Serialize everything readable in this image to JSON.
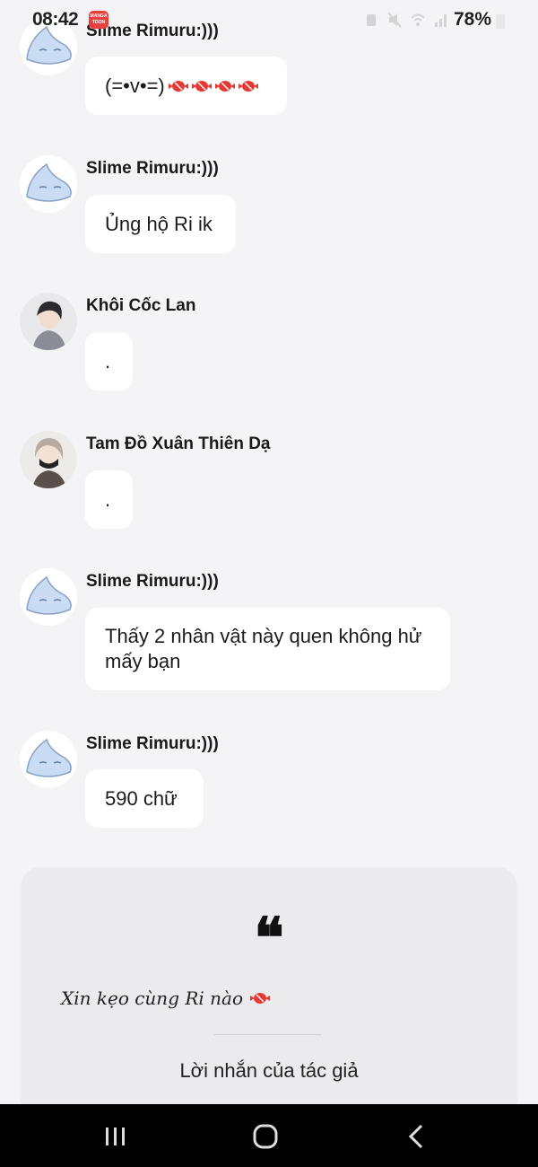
{
  "status_bar": {
    "time": "08:42",
    "app_badge": "MANGA TOON",
    "battery": "78%"
  },
  "messages": [
    {
      "user": "Slime Rimuru:)))",
      "text": "(=•v•=)",
      "candies": 4
    },
    {
      "user": "Slime Rimuru:)))",
      "text": "Ủng hộ Ri ik"
    },
    {
      "user": "Khôi Cốc Lan",
      "text": "."
    },
    {
      "user": "Tam Đồ Xuân Thiên Dạ",
      "text": "."
    },
    {
      "user": "Slime Rimuru:)))",
      "text": "Thấy 2 nhân vật này quen không hử mấy bạn"
    },
    {
      "user": "Slime Rimuru:)))",
      "text": "590 chữ"
    }
  ],
  "author_card": {
    "quote_mark": "❝",
    "note": "Xin kẹo cùng Ri nào",
    "caption": "Lời nhắn của tác giả"
  },
  "nav": {
    "icons": [
      "recent-apps-icon",
      "home-icon",
      "back-icon"
    ]
  },
  "colors": {
    "background": "#f4f4f6",
    "bubble": "#ffffff",
    "card": "#ebebed",
    "candy": "#e53935",
    "nav": "#000000"
  }
}
